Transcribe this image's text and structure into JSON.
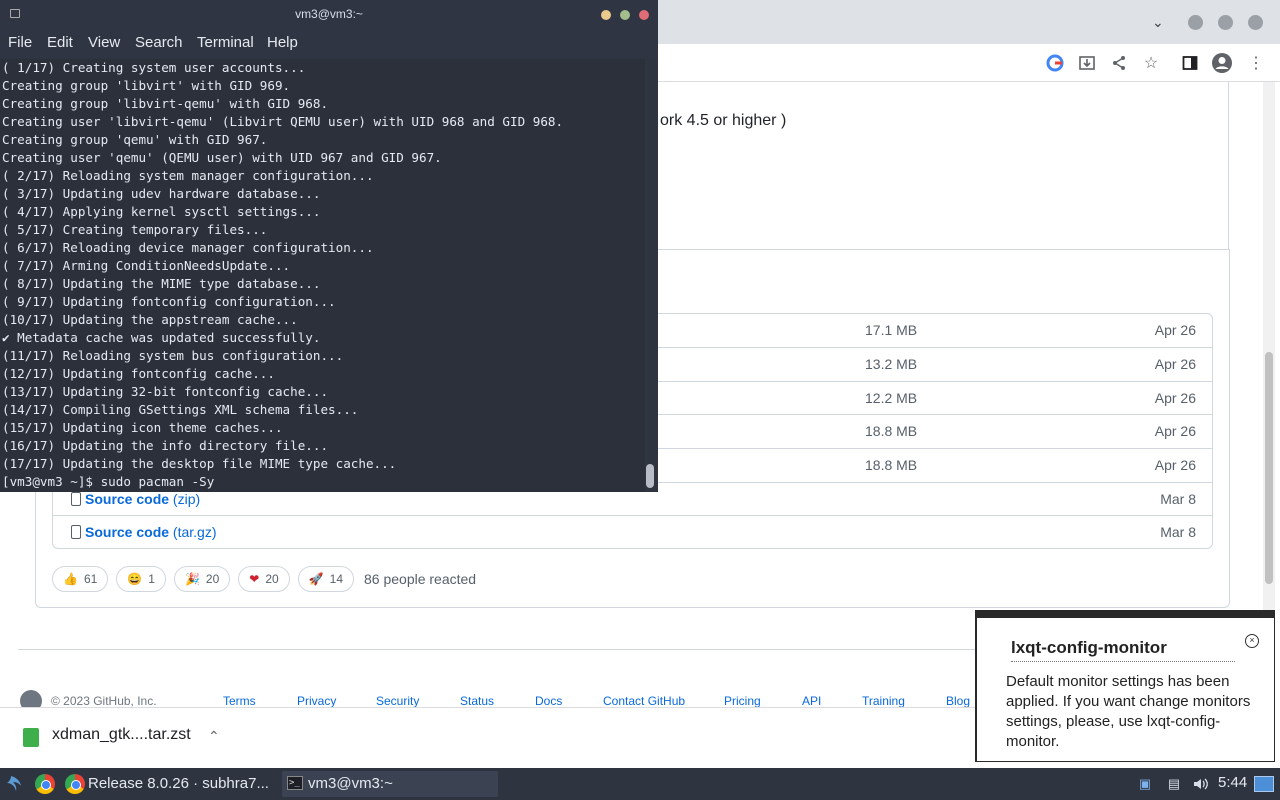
{
  "terminal": {
    "title": "vm3@vm3:~",
    "menu": [
      "File",
      "Edit",
      "View",
      "Search",
      "Terminal",
      "Help"
    ],
    "lines": [
      "( 1/17) Creating system user accounts...",
      "Creating group 'libvirt' with GID 969.",
      "Creating group 'libvirt-qemu' with GID 968.",
      "Creating user 'libvirt-qemu' (Libvirt QEMU user) with UID 968 and GID 968.",
      "Creating group 'qemu' with GID 967.",
      "Creating user 'qemu' (QEMU user) with UID 967 and GID 967.",
      "( 2/17) Reloading system manager configuration...",
      "( 3/17) Updating udev hardware database...",
      "( 4/17) Applying kernel sysctl settings...",
      "( 5/17) Creating temporary files...",
      "( 6/17) Reloading device manager configuration...",
      "( 7/17) Arming ConditionNeedsUpdate...",
      "( 8/17) Updating the MIME type database...",
      "( 9/17) Updating fontconfig configuration...",
      "(10/17) Updating the appstream cache...",
      "✔ Metadata cache was updated successfully.",
      "(11/17) Reloading system bus configuration...",
      "(12/17) Updating fontconfig cache...",
      "(13/17) Updating 32-bit fontconfig cache...",
      "(14/17) Compiling GSettings XML schema files...",
      "(15/17) Updating icon theme caches...",
      "(16/17) Updating the info directory file...",
      "(17/17) Updating the desktop file MIME type cache...",
      "[vm3@vm3 ~]$ sudo pacman -Sy"
    ]
  },
  "browser": {
    "page_partial_text": "ork 4.5 or higher )",
    "assets": [
      {
        "size": "17.1 MB",
        "date": "Apr 26"
      },
      {
        "size": "13.2 MB",
        "date": "Apr 26"
      },
      {
        "size": "12.2 MB",
        "date": "Apr 26"
      },
      {
        "size": "18.8 MB",
        "date": "Apr 26"
      },
      {
        "size": "18.8 MB",
        "date": "Apr 26"
      },
      {
        "name": "Source code",
        "ext": "(zip)",
        "date": "Mar 8"
      },
      {
        "name": "Source code",
        "ext": "(tar.gz)",
        "date": "Mar 8"
      }
    ],
    "reactions": [
      {
        "emoji": "👍",
        "count": "61"
      },
      {
        "emoji": "😄",
        "count": "1"
      },
      {
        "emoji": "🎉",
        "count": "20"
      },
      {
        "emoji": "❤",
        "count": "20"
      },
      {
        "emoji": "🚀",
        "count": "14"
      }
    ],
    "reacted_text": "86 people reacted",
    "footer": {
      "copyright": "© 2023 GitHub, Inc.",
      "links": [
        "Terms",
        "Privacy",
        "Security",
        "Status",
        "Docs",
        "Contact GitHub",
        "Pricing",
        "API",
        "Training",
        "Blog"
      ]
    },
    "download": {
      "filename": "xdman_gtk....tar.zst",
      "chevron": "⌃"
    }
  },
  "notification": {
    "title": "lxqt-config-monitor",
    "body": "Default monitor settings has been applied. If you want change monitors settings, please, use lxqt-config-monitor.",
    "close": "×"
  },
  "taskbar": {
    "browser_task": "Release 8.0.26 · subhra7...",
    "terminal_task": "vm3@vm3:~",
    "term_icon_text": ">_",
    "clock": "5:44"
  }
}
